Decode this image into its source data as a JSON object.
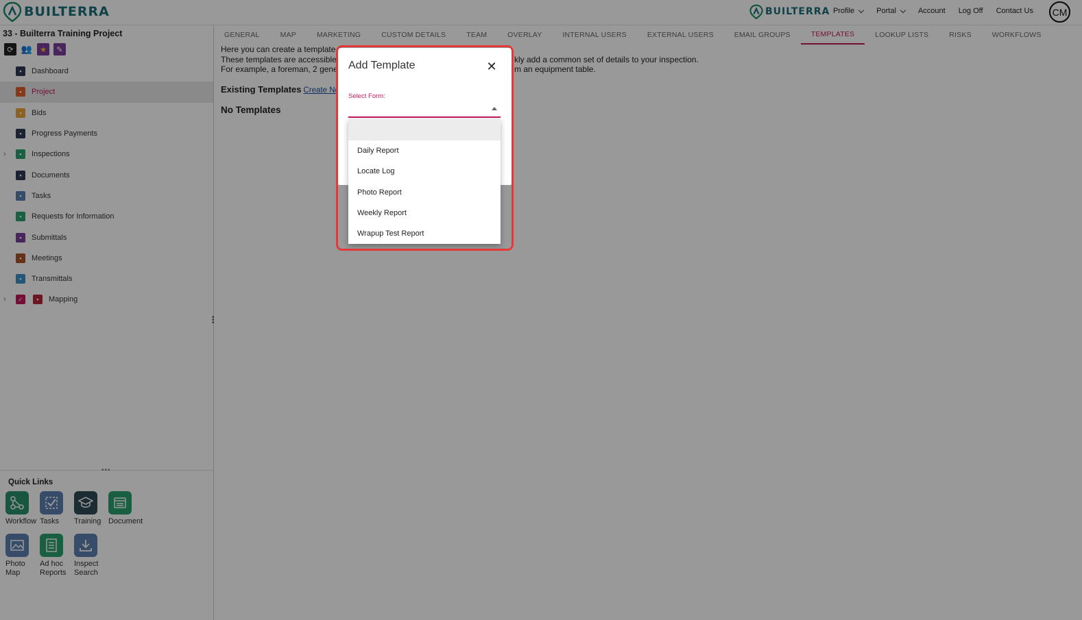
{
  "header": {
    "logo_text": "BUILTERRA",
    "logo2_text": "BUILTERRA",
    "nav": [
      {
        "label": "Profile",
        "dropdown": true
      },
      {
        "label": "Portal",
        "dropdown": true
      },
      {
        "label": "Account",
        "dropdown": false
      },
      {
        "label": "Log Off",
        "dropdown": false
      },
      {
        "label": "Contact Us",
        "dropdown": false
      }
    ],
    "avatar_initials": "CM"
  },
  "sidebar": {
    "project_title": "33 - Builterra Training Project",
    "items": [
      {
        "label": "Dashboard",
        "icon": "dashboard-icon",
        "color": "#2e3b55"
      },
      {
        "label": "Project",
        "icon": "project-icon",
        "color": "#e0602a",
        "active": true
      },
      {
        "label": "Bids",
        "icon": "bids-icon",
        "color": "#e8a33b"
      },
      {
        "label": "Progress Payments",
        "icon": "payments-icon",
        "color": "#2e3b55"
      },
      {
        "label": "Inspections",
        "icon": "inspections-icon",
        "color": "#2aa06e",
        "expandable": true
      },
      {
        "label": "Documents",
        "icon": "documents-icon",
        "color": "#2e3b55"
      },
      {
        "label": "Tasks",
        "icon": "tasks-icon",
        "color": "#5b7fb0"
      },
      {
        "label": "Requests for Information",
        "icon": "rfi-icon",
        "color": "#2aa06e"
      },
      {
        "label": "Submittals",
        "icon": "submittals-icon",
        "color": "#7a3e9d"
      },
      {
        "label": "Meetings",
        "icon": "meetings-icon",
        "color": "#a8532a"
      },
      {
        "label": "Transmittals",
        "icon": "transmittals-icon",
        "color": "#3b8fc7"
      },
      {
        "label": "Mapping",
        "icon": "mapping-icon",
        "color": "#b5263a",
        "expandable": true,
        "checkbox": true
      }
    ],
    "quick_links_title": "Quick Links",
    "quick_links": [
      {
        "label": "Workflow",
        "icon": "workflow-icon",
        "color": "#2a8f6a"
      },
      {
        "label": "Tasks",
        "icon": "tasks-icon",
        "color": "#5b7fb0"
      },
      {
        "label": "Training",
        "icon": "training-icon",
        "color": "#2e4a55"
      },
      {
        "label": "Document",
        "icon": "document-icon",
        "color": "#2aa06e"
      },
      {
        "label": "Photo Map",
        "icon": "photo-map-icon",
        "color": "#5b7fb0"
      },
      {
        "label": "Ad hoc Reports",
        "icon": "reports-icon",
        "color": "#2aa06e"
      },
      {
        "label": "Inspect Search",
        "icon": "download-icon",
        "color": "#5b7fb0"
      }
    ]
  },
  "main": {
    "tabs": [
      "GENERAL",
      "MAP",
      "MARKETING",
      "CUSTOM DETAILS",
      "TEAM",
      "OVERLAY",
      "INTERNAL USERS",
      "EXTERNAL USERS",
      "EMAIL GROUPS",
      "TEMPLATES",
      "LOOKUP LISTS",
      "RISKS",
      "WORKFLOWS"
    ],
    "active_tab": "TEMPLATES",
    "intro_lines": [
      "Here you can create a template o",
      "These templates are accessible",
      "For example, a foreman, 2 gener"
    ],
    "intro_lines_right": [
      "",
      "kly add a common set of details to your inspection.",
      "m an equipment table."
    ],
    "existing_label": "Existing Templates",
    "create_link": "Create Ne",
    "no_templates": "No Templates"
  },
  "dialog": {
    "title": "Add Template",
    "select_label": "Select Form:",
    "options": [
      "",
      "Daily Report",
      "Locate Log",
      "Photo Report",
      "Weekly Report",
      "Wrapup Test Report"
    ],
    "accent_color": "#c2185b",
    "highlight_color": "#e53935"
  }
}
